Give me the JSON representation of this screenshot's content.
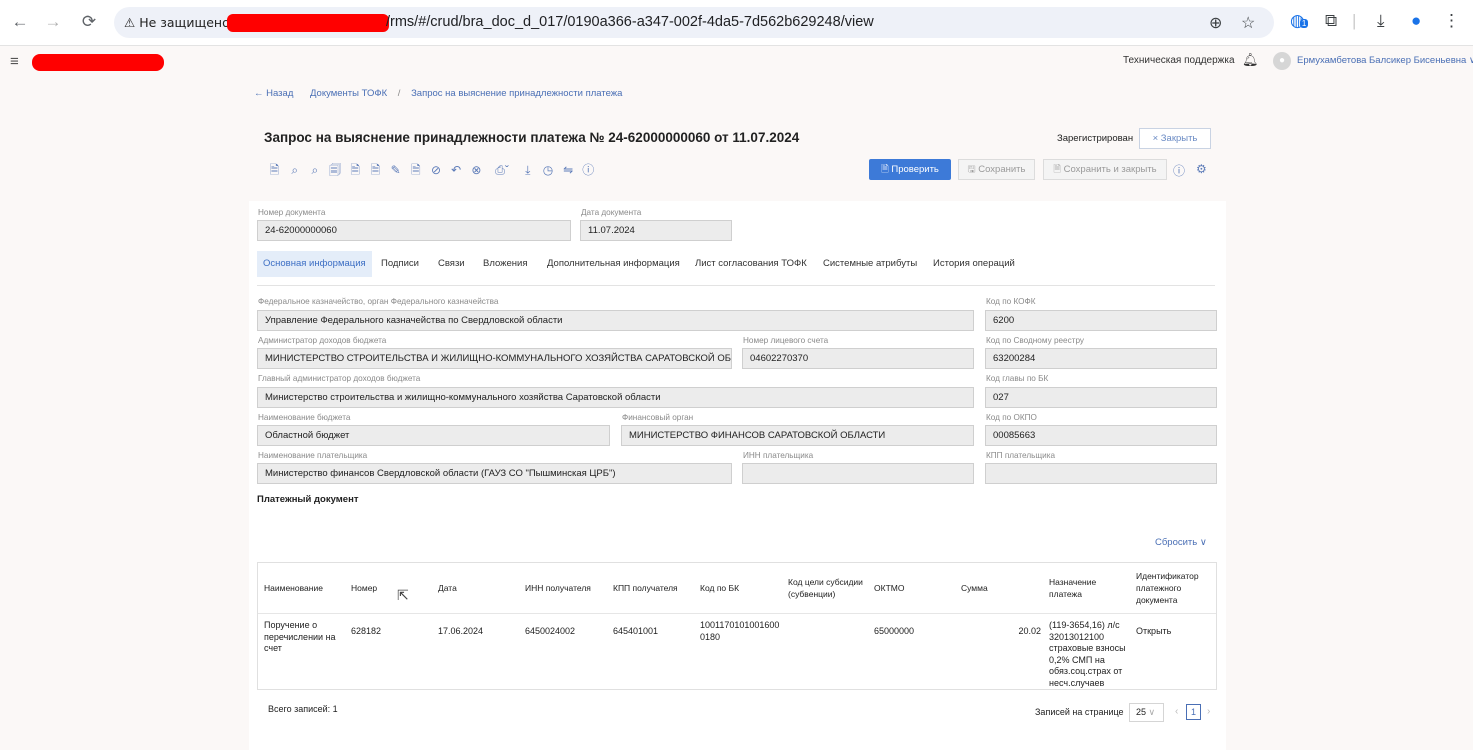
{
  "browser": {
    "security_label": "Не защищено",
    "url": "/rms/#/crud/bra_doc_d_017/0190a366-a347-002f-4da5-7d562b629248/view",
    "extension_badge": "1"
  },
  "header": {
    "support_label": "Техническая поддержка",
    "user_name": "Ермухамбетова Балсикер Бисеньевна"
  },
  "breadcrumbs": {
    "back": "← Назад",
    "items": [
      "Документы ТОФК",
      "Запрос на выяснение принадлежности платежа"
    ],
    "separator": "/"
  },
  "document": {
    "title": "Запрос на выяснение принадлежности платежа № 24-62000000060 от 11.07.2024",
    "status": "Зарегистрирован",
    "close_label": "× Закрыть"
  },
  "toolbar": {
    "check_label": "Проверить",
    "save_label": "Сохранить",
    "save_close_label": "Сохранить и закрыть"
  },
  "top_fields": {
    "doc_number_label": "Номер документа",
    "doc_number": "24-62000000060",
    "doc_date_label": "Дата документа",
    "doc_date": "11.07.2024"
  },
  "tabs": [
    "Основная информация",
    "Подписи",
    "Связи",
    "Вложения",
    "Дополнительная информация",
    "Лист согласования ТОФК",
    "Системные атрибуты",
    "История операций"
  ],
  "form": {
    "fk_label": "Федеральное казначейство, орган Федерального казначейства",
    "fk_value": "Управление Федерального казначейства по Свердловской области",
    "kofk_label": "Код по КОФК",
    "kofk_value": "6200",
    "adm_label": "Администратор доходов бюджета",
    "adm_value": "МИНИСТЕРСТВО СТРОИТЕЛЬСТВА И ЖИЛИЩНО-КОММУНАЛЬНОГО ХОЗЯЙСТВА САРАТОВСКОЙ ОБЛАСТИ",
    "acc_label": "Номер лицевого счета",
    "acc_value": "04602270370",
    "reestr_label": "Код по Сводному реестру",
    "reestr_value": "63200284",
    "main_adm_label": "Главный администратор доходов бюджета",
    "main_adm_value": "Министерство строительства и жилищно-коммунального хозяйства Саратовской области",
    "glava_label": "Код главы по БК",
    "glava_value": "027",
    "budget_label": "Наименование бюджета",
    "budget_value": "Областной бюджет",
    "fin_label": "Финансовый орган",
    "fin_value": "МИНИСТЕРСТВО ФИНАНСОВ САРАТОВСКОЙ ОБЛАСТИ",
    "okpo_label": "Код по ОКПО",
    "okpo_value": "00085663",
    "payer_label": "Наименование плательщика",
    "payer_value": "Министерство финансов Свердловской области (ГАУЗ СО \"Пышминская ЦРБ\")",
    "inn_label": "ИНН плательщика",
    "inn_value": "",
    "kpp_label": "КПП плательщика",
    "kpp_value": ""
  },
  "payment_section": {
    "title": "Платежный документ",
    "reset_label": "Сбросить ∨",
    "columns": [
      "Наименование",
      "Номер",
      "Дата",
      "ИНН получателя",
      "КПП получателя",
      "Код по БК",
      "Код цели субсидии (субвенции)",
      "ОКТМО",
      "Сумма",
      "Назначение платежа",
      "Идентификатор платежного документа"
    ],
    "row": {
      "name": "Поручение о перечислении на счет",
      "number": "628182",
      "date": "17.06.2024",
      "inn": "6450024002",
      "kpp": "645401001",
      "kbk": "10011701010016000180",
      "goal": "",
      "oktmo": "65000000",
      "sum": "20.02",
      "purpose": "(119-3654,16) л/с 32013012100 страховые взносы 0,2% СМП на обяз.соц.страх от несч.случаев",
      "identifier": "Открыть"
    },
    "total_label": "Всего записей: 1",
    "per_page_label": "Записей на странице",
    "per_page_value": "25",
    "current_page": "1"
  }
}
